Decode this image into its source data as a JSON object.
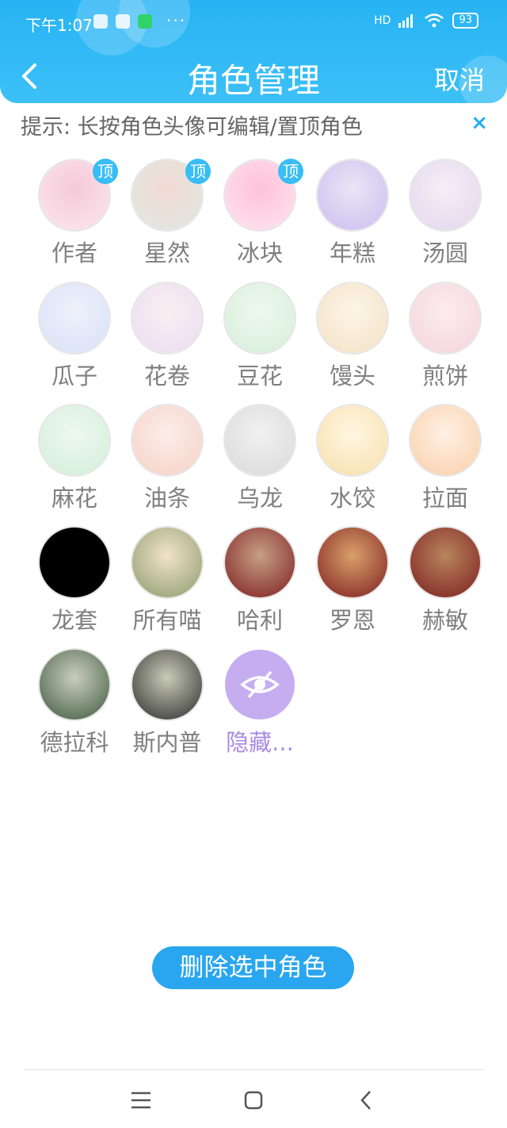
{
  "status_bar": {
    "time": "下午1:07",
    "dots": "···",
    "network": "HD",
    "battery": "93"
  },
  "header": {
    "title": "角色管理",
    "cancel_label": "取消"
  },
  "tip": {
    "text": "提示: 长按角色头像可编辑/置顶角色",
    "close": "×"
  },
  "pin_label": "顶",
  "roles": [
    {
      "name": "作者",
      "pinned": true
    },
    {
      "name": "星然",
      "pinned": true
    },
    {
      "name": "冰块",
      "pinned": true
    },
    {
      "name": "年糕",
      "pinned": false
    },
    {
      "name": "汤圆",
      "pinned": false
    },
    {
      "name": "瓜子",
      "pinned": false
    },
    {
      "name": "花卷",
      "pinned": false
    },
    {
      "name": "豆花",
      "pinned": false
    },
    {
      "name": "馒头",
      "pinned": false
    },
    {
      "name": "煎饼",
      "pinned": false
    },
    {
      "name": "麻花",
      "pinned": false
    },
    {
      "name": "油条",
      "pinned": false
    },
    {
      "name": "乌龙",
      "pinned": false
    },
    {
      "name": "水饺",
      "pinned": false
    },
    {
      "name": "拉面",
      "pinned": false
    },
    {
      "name": "龙套",
      "pinned": false
    },
    {
      "name": "所有喵",
      "pinned": false
    },
    {
      "name": "哈利",
      "pinned": false
    },
    {
      "name": "罗恩",
      "pinned": false
    },
    {
      "name": "赫敏",
      "pinned": false
    },
    {
      "name": "德拉科",
      "pinned": false
    },
    {
      "name": "斯内普",
      "pinned": false
    },
    {
      "name": "隐藏...",
      "pinned": false
    }
  ],
  "delete_button": "删除选中角色",
  "colors": {
    "accent": "#27b3f4",
    "pin_badge": "#38bdf5",
    "hidden_purple": "#a98be3",
    "button": "#29a6ef"
  }
}
